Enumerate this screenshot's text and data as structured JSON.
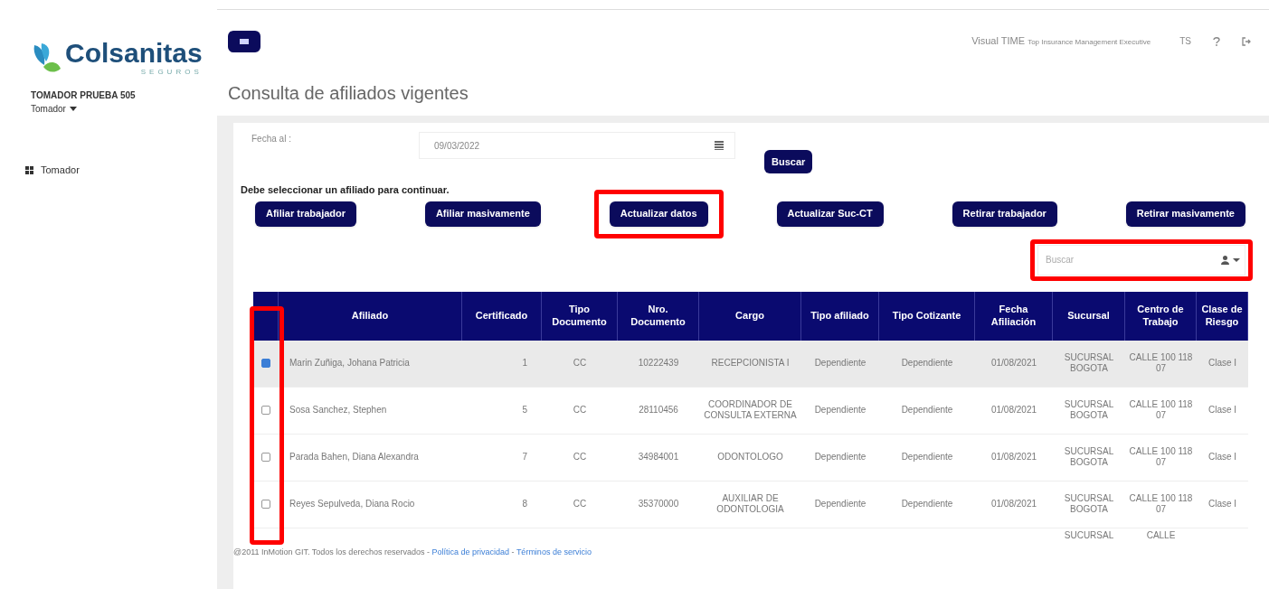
{
  "brand": {
    "name": "Colsanitas",
    "tagline": "SEGUROS"
  },
  "user": {
    "name": "TOMADOR PRUEBA 505",
    "role": "Tomador"
  },
  "sidebar": {
    "items": [
      {
        "label": "Tomador",
        "selected": false
      }
    ]
  },
  "topbar": {
    "product": "Visual TIME",
    "subtitle": "Top Insurance Management Executive",
    "initials": "TS"
  },
  "page_title": "Consulta de afiliados vigentes",
  "filter": {
    "label": "Fecha al :",
    "value": "09/03/2022",
    "button": "Buscar"
  },
  "notice": "Debe seleccionar un afiliado para continuar.",
  "actions": [
    {
      "label": "Afiliar trabajador",
      "highlighted": false
    },
    {
      "label": "Afiliar masivamente",
      "highlighted": false
    },
    {
      "label": "Actualizar datos",
      "highlighted": true
    },
    {
      "label": "Actualizar Suc-CT",
      "highlighted": false
    },
    {
      "label": "Retirar trabajador",
      "highlighted": false
    },
    {
      "label": "Retirar masivamente",
      "highlighted": false
    }
  ],
  "search": {
    "placeholder": "Buscar",
    "highlighted": true
  },
  "table": {
    "checkbox_column_highlighted": true,
    "columns": [
      "Afiliado",
      "Certificado",
      "Tipo Documento",
      "Nro. Documento",
      "Cargo",
      "Tipo afiliado",
      "Tipo Cotizante",
      "Fecha Afiliación",
      "Sucursal",
      "Centro de Trabajo",
      "Clase de Riesgo"
    ],
    "rows": [
      {
        "selected": true,
        "cells": [
          "Marin Zuñiga, Johana Patricia",
          "1",
          "CC",
          "10222439",
          "RECEPCIONISTA I",
          "Dependiente",
          "Dependiente",
          "01/08/2021",
          "SUCURSAL BOGOTA",
          "CALLE 100 118 07",
          "Clase I"
        ]
      },
      {
        "selected": false,
        "cells": [
          "Sosa Sanchez, Stephen",
          "5",
          "CC",
          "28110456",
          "COORDINADOR DE CONSULTA EXTERNA",
          "Dependiente",
          "Dependiente",
          "01/08/2021",
          "SUCURSAL BOGOTA",
          "CALLE 100 118 07",
          "Clase I"
        ]
      },
      {
        "selected": false,
        "cells": [
          "Parada Bahen, Diana Alexandra",
          "7",
          "CC",
          "34984001",
          "ODONTOLOGO",
          "Dependiente",
          "Dependiente",
          "01/08/2021",
          "SUCURSAL BOGOTA",
          "CALLE 100 118 07",
          "Clase I"
        ]
      },
      {
        "selected": false,
        "cells": [
          "Reyes Sepulveda, Diana Rocio",
          "8",
          "CC",
          "35370000",
          "AUXILIAR DE ODONTOLOGIA",
          "Dependiente",
          "Dependiente",
          "01/08/2021",
          "SUCURSAL BOGOTA",
          "CALLE 100 118 07",
          "Clase I"
        ]
      }
    ],
    "partial_row": {
      "sucursal": "SUCURSAL",
      "centro": "CALLE"
    }
  },
  "footer": {
    "text": "@2011 InMotion GIT. Todos los derechos reservados",
    "links": [
      "Política de privacidad",
      "Términos de servicio"
    ],
    "separator": "-"
  }
}
